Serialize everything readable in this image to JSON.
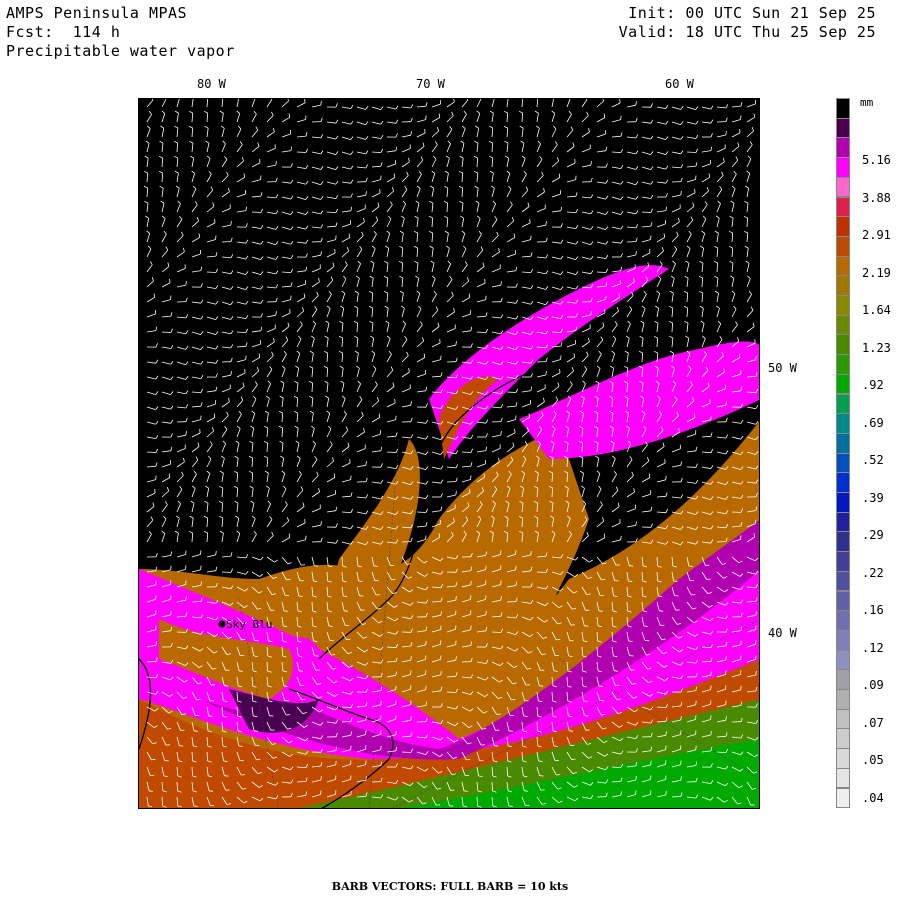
{
  "header": {
    "model": "AMPS Peninsula MPAS",
    "forecast": "Fcst:  114 h",
    "field": "Precipitable water vapor",
    "init": "Init: 00 UTC Sun 21 Sep 25",
    "valid": "Valid: 18 UTC Thu 25 Sep 25"
  },
  "map": {
    "longitude_labels": [
      "80 W",
      "70 W",
      "60 W"
    ],
    "latitude_labels": [
      "50 W",
      "40 W"
    ],
    "station": {
      "name": "Sky Blu"
    },
    "barb_caption": "BARB VECTORS:  FULL BARB = 10 kts"
  },
  "colorbar": {
    "unit": "mm",
    "labels": [
      "5.16",
      "3.88",
      "2.91",
      "2.19",
      "1.64",
      "1.23",
      ".92",
      ".69",
      ".52",
      ".39",
      ".29",
      ".22",
      ".16",
      ".12",
      ".09",
      ".07",
      ".05",
      ".04"
    ],
    "colors": [
      "#000000",
      "#4a0050",
      "#b000b0",
      "#ff00ff",
      "#ff66cc",
      "#e0204a",
      "#c03000",
      "#c04a00",
      "#b86a00",
      "#a07800",
      "#8a8a00",
      "#6a8a00",
      "#4a8a00",
      "#2a9a00",
      "#00aa00",
      "#00a050",
      "#008a8a",
      "#0070a0",
      "#0050c0",
      "#0030d0",
      "#0018c0",
      "#2020a0",
      "#303090",
      "#404098",
      "#5050a0",
      "#6060a8",
      "#7070b0",
      "#8080b8",
      "#9090c0",
      "#a0a0a8",
      "#b0b0b0",
      "#c0c0c0",
      "#cccccc",
      "#d8d8d8",
      "#e4e4e4",
      "#eeeeee"
    ]
  }
}
